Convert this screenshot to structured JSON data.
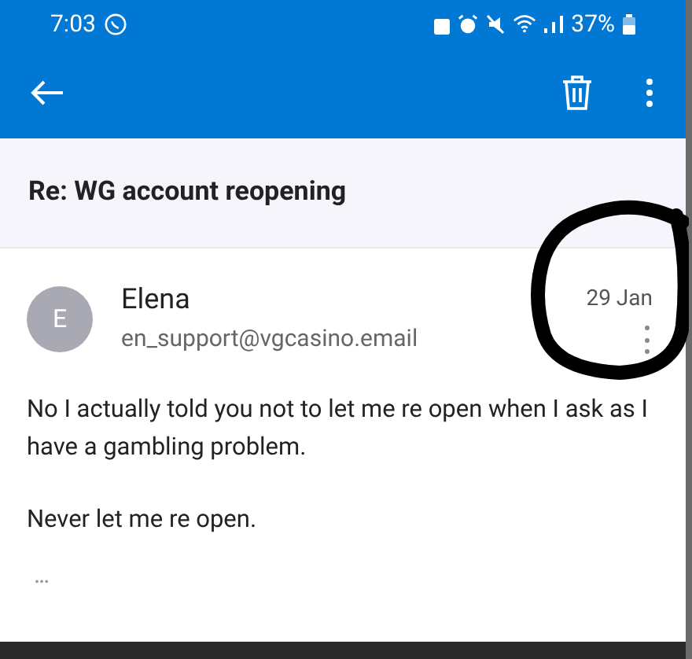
{
  "status_bar": {
    "time": "7:03",
    "battery": "37%"
  },
  "subject": "Re: WG account reopening",
  "message": {
    "avatar_letter": "E",
    "sender": "Elena",
    "address": "en_support@vgcasino.email",
    "date": "29 Jan",
    "paragraphs": [
      "No I actually told you not to let me re open when I ask as I have a gambling problem.",
      "Never let me re open."
    ],
    "more": "•••"
  }
}
